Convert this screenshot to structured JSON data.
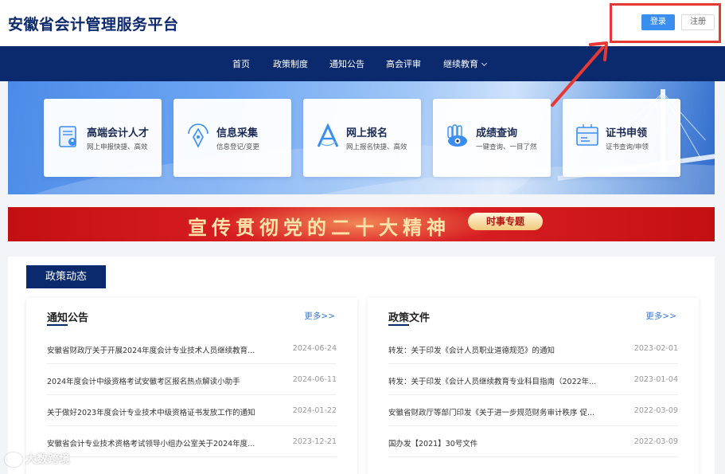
{
  "header": {
    "site_title": "安徽省会计管理服务平台",
    "login_label": "登录",
    "register_label": "注册"
  },
  "nav": {
    "items": [
      {
        "label": "首页"
      },
      {
        "label": "政策制度"
      },
      {
        "label": "通知公告"
      },
      {
        "label": "高会评审"
      },
      {
        "label": "继续教育",
        "has_dropdown": true
      }
    ]
  },
  "services": [
    {
      "title": "高端会计人才",
      "subtitle": "网上申报快捷、高效",
      "icon": "document-person-icon"
    },
    {
      "title": "信息采集",
      "subtitle": "信息登记/变更",
      "icon": "pen-nib-icon"
    },
    {
      "title": "网上报名",
      "subtitle": "网上报名快捷、高效",
      "icon": "letter-a-icon"
    },
    {
      "title": "成绩查询",
      "subtitle": "一键查询、一目了然",
      "icon": "hand-eye-icon"
    },
    {
      "title": "证书申领",
      "subtitle": "证书查询/申领",
      "icon": "certificate-icon"
    }
  ],
  "promo": {
    "text": "宣传贯彻党的二十大精神",
    "badge": "时事专题"
  },
  "section": {
    "tag": "政策动态",
    "columns": [
      {
        "title": "通知公告",
        "more": "更多>>",
        "rows": [
          {
            "title": "安徽省财政厅关于开展2024年度会计专业技术人员继续教育...",
            "date": "2024-06-24"
          },
          {
            "title": "2024年度会计中级资格考试安徽考区报名热点解读小助手",
            "date": "2024-06-11"
          },
          {
            "title": "关于做好2023年度会计专业技术中级资格证书发放工作的通知",
            "date": "2024-01-22"
          },
          {
            "title": "安徽省会计专业技术资格考试领导小组办公室关于2024年度...",
            "date": "2023-12-21"
          }
        ]
      },
      {
        "title": "政策文件",
        "more": "更多>>",
        "rows": [
          {
            "title": "转发：关于印发《会计人员职业道德规范》的通知",
            "date": "2023-02-01"
          },
          {
            "title": "转发：关于印发《会计人员继续教育专业科目指南（2022年...",
            "date": "2023-01-04"
          },
          {
            "title": "安徽省财政厅等部门印发《关于进一步规范财务审计秩序 促...",
            "date": "2022-03-09"
          },
          {
            "title": "国办发【2021】30号文件",
            "date": "2022-03-09"
          }
        ]
      }
    ]
  },
  "watermark": "大数跨境",
  "colors": {
    "brand_navy": "#0b2a6e",
    "login_blue": "#3a8ef0",
    "highlight_red": "#e53935",
    "promo_red": "#d11a1d"
  }
}
